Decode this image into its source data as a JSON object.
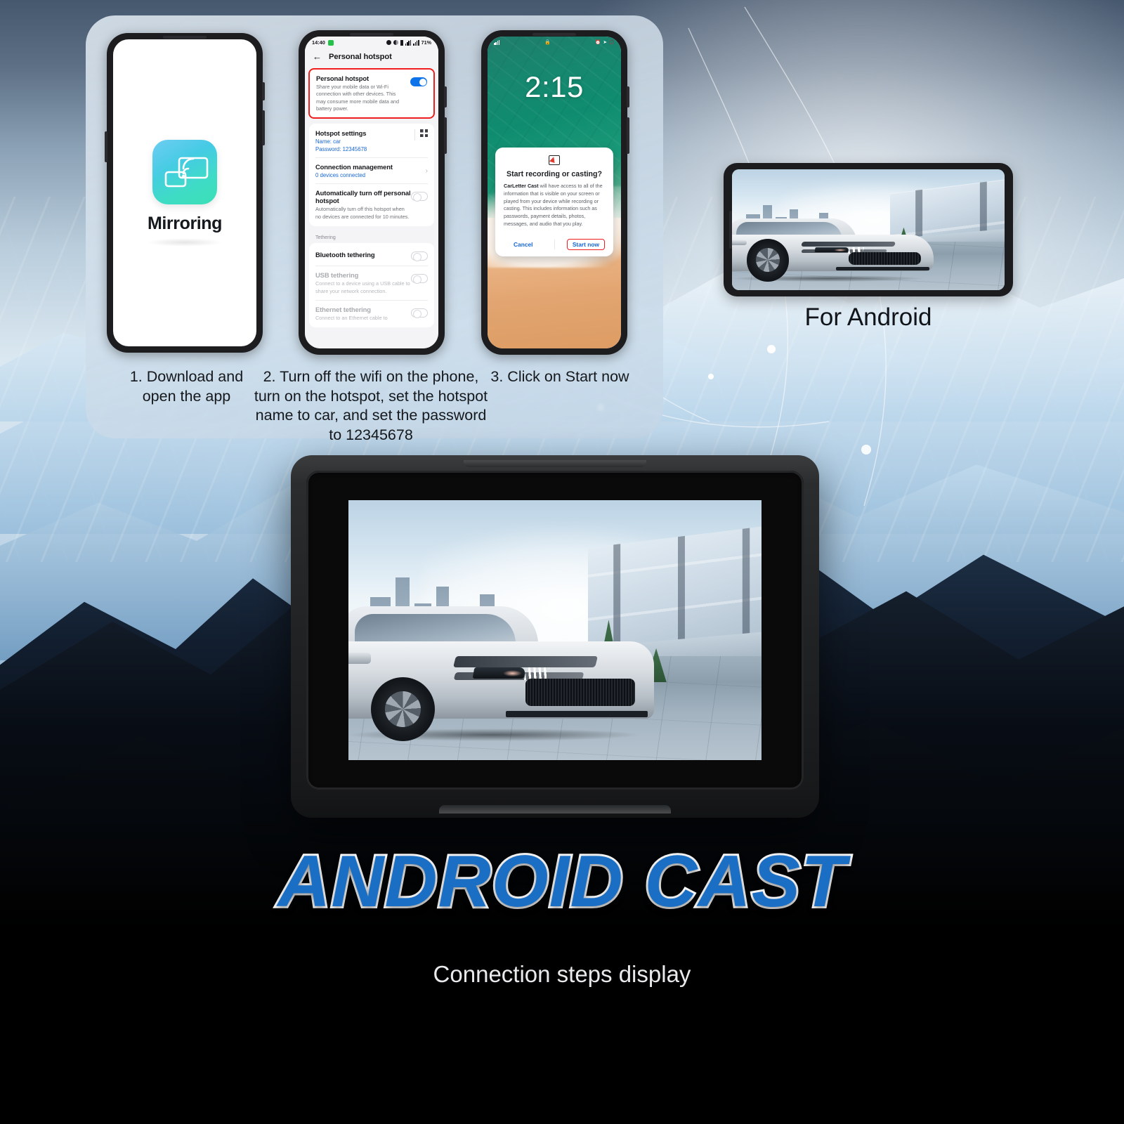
{
  "page": {
    "title": "ANDROID CAST",
    "subtitle": "Connection steps display",
    "for_android_label": "For Android",
    "accent_blue": "#1a6fc4",
    "highlight_red": "#ef1d1d",
    "link_blue": "#1566d6"
  },
  "steps": [
    {
      "id": "step-1",
      "caption": "1. Download and\nopen the app"
    },
    {
      "id": "step-2",
      "caption": "2.  Turn off the wifi on the phone,\nturn on the hotspot, set the hotspot\nname to car, and set the password\nto 12345678"
    },
    {
      "id": "step-3",
      "caption": "3. Click on Start now"
    }
  ],
  "phone1": {
    "app_icon_name": "screen-mirroring-icon",
    "app_label": "Mirroring"
  },
  "phone2": {
    "statusbar": {
      "time": "14:40",
      "battery": "71%"
    },
    "appbar_title": "Personal hotspot",
    "back_icon": "back-arrow-icon",
    "hotspot": {
      "title": "Personal hotspot",
      "description": "Share your mobile data or Wi-Fi connection with other devices. This may consume more mobile data and battery power.",
      "toggle_state": "on"
    },
    "hotspot_settings": {
      "title": "Hotspot settings",
      "name": "Name: car",
      "password": "Password: 12345678",
      "qr_icon": "qr-code-icon"
    },
    "connection_management": {
      "title": "Connection management",
      "value": "0 devices connected",
      "chevron": "chevron-right-icon"
    },
    "auto_off": {
      "title": "Automatically turn off personal hotspot",
      "description": "Automatically turn off this hotspot when no devices are connected for 10 minutes.",
      "toggle_state": "off"
    },
    "tethering_label": "Tethering",
    "tethering": [
      {
        "title": "Bluetooth tethering",
        "description": "",
        "toggle_state": "off",
        "disabled": false
      },
      {
        "title": "USB tethering",
        "description": "Connect to a device using a USB cable to share your network connection.",
        "toggle_state": "off",
        "disabled": true
      },
      {
        "title": "Ethernet tethering",
        "description": "Connect to an Ethernet cable to",
        "toggle_state": "off",
        "disabled": true
      }
    ]
  },
  "phone3": {
    "clock": "2:15",
    "statusbar": {
      "signal_icon": "signal-bars-icon",
      "lock_icon": "lock-icon",
      "alarm_icon": "alarm-icon",
      "location_icon": "location-icon",
      "headphones_icon": "headphones-icon"
    },
    "dialog": {
      "icon": "cast-screen-icon",
      "title": "Start recording or casting?",
      "app_name": "CarLetter Cast",
      "body": " will have access to all of the information that is visible on your screen or played from your device while recording or casting. This includes information such as passwords, payment details, photos, messages, and audio that you play.",
      "cancel_label": "Cancel",
      "start_label": "Start now"
    }
  }
}
